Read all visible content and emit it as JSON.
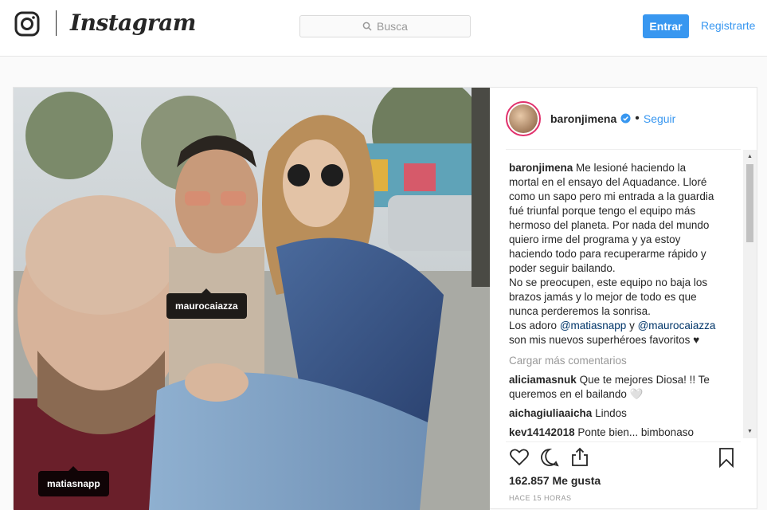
{
  "header": {
    "logo_text": "Instagram",
    "search_placeholder": "Busca",
    "login_label": "Entrar",
    "register_label": "Registrarte"
  },
  "post": {
    "author": "baronjimena",
    "follow_label": "Seguir",
    "separator": "•",
    "tags": [
      "maurocaiazza",
      "matiasnapp"
    ],
    "caption_user": "baronjimena",
    "caption_lines": [
      "Me lesioné haciendo la",
      "mortal en el ensayo del Aquadance. Lloré",
      "como un sapo pero mi entrada a la guardia",
      "fué triunfal porque tengo el equipo más",
      "hermoso del planeta. Por nada del mundo",
      "quiero irme del programa y ya estoy",
      "haciendo todo para recuperarme rápido y",
      "poder seguir bailando.",
      "No se preocupen, este equipo no baja los",
      "brazos jamás y lo mejor de todo es que",
      "nunca perderemos la sonrisa."
    ],
    "caption_mentions_prefix": "Los adoro",
    "caption_mention_1": "@matiasnapp",
    "caption_mentions_and": "y",
    "caption_mention_2": "@maurocaiazza",
    "caption_last": "son mis nuevos superhéroes favoritos ♥",
    "load_more": "Cargar más comentarios",
    "comments": [
      {
        "user": "aliciamasnuk",
        "text": "Que te mejores Diosa! !! Te"
      },
      {
        "user": "",
        "text": "queremos en el bailando 🤍"
      },
      {
        "user": "aichagiuliaaicha",
        "text": "Lindos"
      },
      {
        "user": "kev14142018",
        "text": "Ponte bien... bimbonaso"
      }
    ],
    "likes": "162.857 Me gusta",
    "time": "HACE 15 HORAS"
  },
  "colors": {
    "accent": "#3897f0",
    "border": "#e6e6e6",
    "mention": "#003569"
  },
  "icons": [
    "instagram-logo-icon",
    "search-icon",
    "verified-icon",
    "heart-icon",
    "comment-icon",
    "share-icon",
    "bookmark-icon"
  ]
}
